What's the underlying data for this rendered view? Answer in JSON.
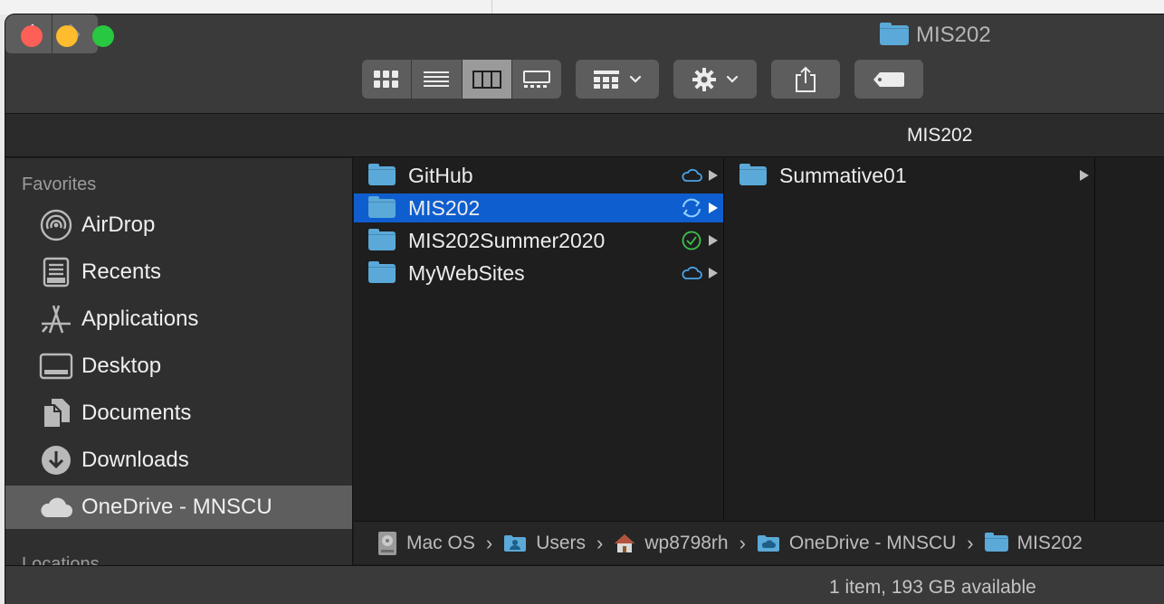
{
  "window": {
    "title": "MIS202"
  },
  "path_header": {
    "label": "MIS202"
  },
  "sidebar": {
    "favorites_heading": "Favorites",
    "locations_heading": "Locations",
    "items": [
      {
        "label": "AirDrop",
        "icon": "airdrop-icon"
      },
      {
        "label": "Recents",
        "icon": "recents-icon"
      },
      {
        "label": "Applications",
        "icon": "applications-icon"
      },
      {
        "label": "Desktop",
        "icon": "desktop-icon"
      },
      {
        "label": "Documents",
        "icon": "documents-icon"
      },
      {
        "label": "Downloads",
        "icon": "downloads-icon"
      },
      {
        "label": "OneDrive - MNSCU",
        "icon": "cloud-icon",
        "selected": true
      }
    ]
  },
  "column1": {
    "items": [
      {
        "name": "GitHub",
        "status": "cloud-only-icon"
      },
      {
        "name": "MIS202",
        "status": "syncing-icon",
        "selected": true
      },
      {
        "name": "MIS202Summer2020",
        "status": "synced-check-icon"
      },
      {
        "name": "MyWebSites",
        "status": "cloud-only-icon"
      }
    ]
  },
  "column2": {
    "items": [
      {
        "name": "Summative01"
      }
    ]
  },
  "path_bar": {
    "crumbs": [
      "Mac OS",
      "Users",
      "wp8798rh",
      "OneDrive - MNSCU",
      "MIS202"
    ]
  },
  "status_bar": {
    "text": "1 item, 193 GB available"
  },
  "colors": {
    "selection": "#0f5ecf",
    "folder": "#5aa9d8",
    "cloud_status": "#4aa3e8",
    "synced_status": "#3cc24a"
  }
}
